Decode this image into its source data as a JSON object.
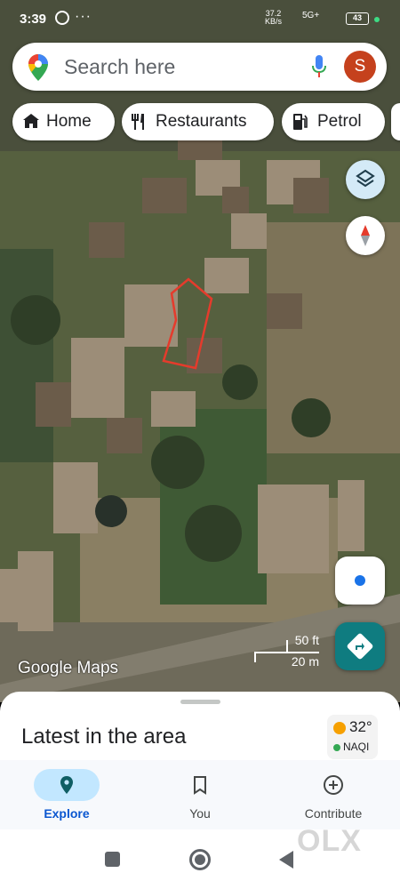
{
  "status_bar": {
    "time": "3:39",
    "more": "···",
    "net_speed": "37.2",
    "net_unit": "KB/s",
    "signal": "5G+",
    "battery": "43"
  },
  "search": {
    "placeholder": "Search here",
    "avatar_letter": "S"
  },
  "chips": [
    {
      "label": "Home",
      "icon": "home-icon"
    },
    {
      "label": "Restaurants",
      "icon": "restaurant-icon"
    },
    {
      "label": "Petrol",
      "icon": "fuel-icon"
    }
  ],
  "map": {
    "scale_ft": "50 ft",
    "scale_m": "20 m",
    "attribution": "Google Maps",
    "view": "satellite",
    "highlight_color": "#e53b2c"
  },
  "sheet": {
    "title": "Latest in the area",
    "temperature": "32°",
    "aqi_label": "NAQI"
  },
  "bottom_nav": [
    {
      "label": "Explore",
      "icon": "explore-pin-icon",
      "active": true
    },
    {
      "label": "You",
      "icon": "bookmark-icon",
      "active": false
    },
    {
      "label": "Contribute",
      "icon": "add-circle-icon",
      "active": false
    }
  ],
  "watermark": "OLX",
  "colors": {
    "accent": "#0b57d0",
    "directions": "#0f7c80",
    "active_pill": "#c2e7ff",
    "avatar": "#c5411d"
  }
}
